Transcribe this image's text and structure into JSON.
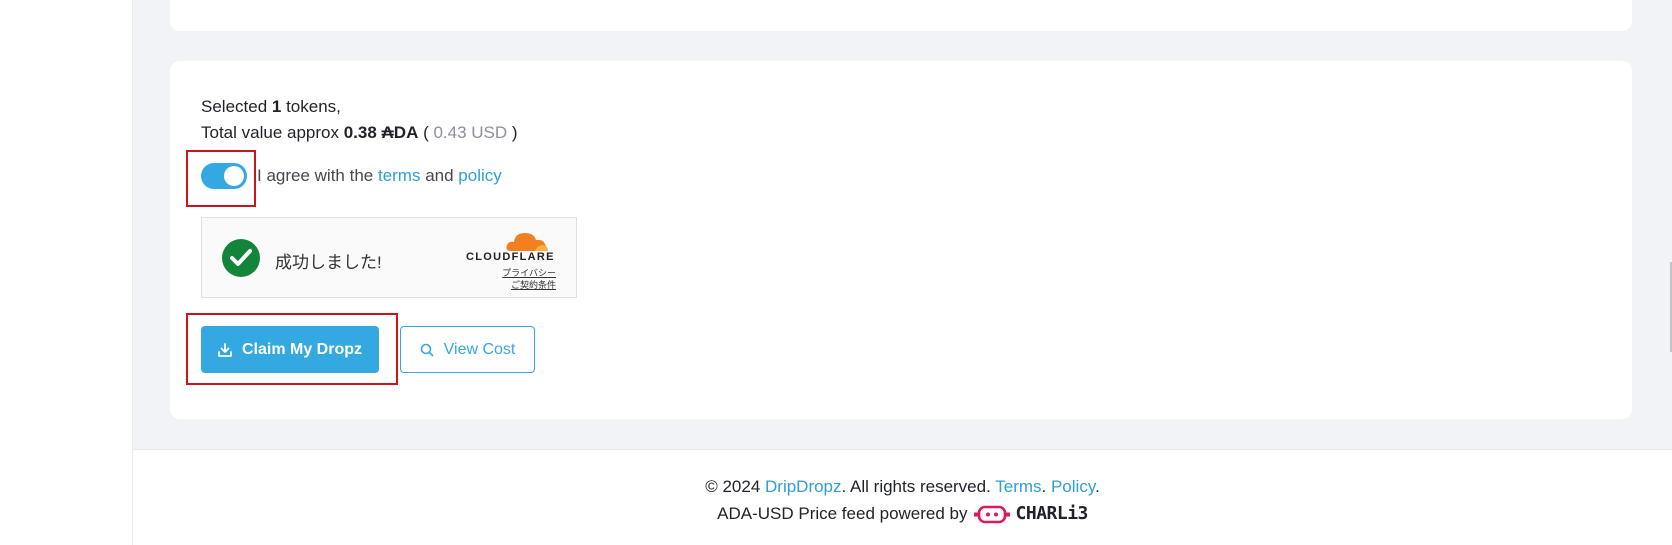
{
  "summary": {
    "line1_prefix": "Selected ",
    "token_count": "1",
    "line1_suffix": " tokens,",
    "line2_prefix": "Total value approx ",
    "ada_value": "0.38 ₳DA",
    "paren_open": " ( ",
    "usd_value": "0.43 USD",
    "paren_close": " )"
  },
  "agreement": {
    "toggle_on": true,
    "text_prefix": "I agree with the ",
    "terms_link": "terms",
    "text_mid": " and ",
    "policy_link": "policy"
  },
  "captcha": {
    "status_text": "成功しました!",
    "brand": "CLOUDFLARE",
    "privacy_link": "プライバシー",
    "terms_link": "ご契約条件"
  },
  "buttons": {
    "claim_label": "Claim My Dropz",
    "view_cost_label": "View Cost"
  },
  "footer": {
    "copyright_prefix": "© 2024 ",
    "brand_link": "DripDropz",
    "rights_text": ". All rights reserved. ",
    "terms_link": "Terms",
    "sep": ". ",
    "policy_link": "Policy",
    "end": ".",
    "price_feed_text": "ADA-USD Price feed powered by",
    "partner_name": "CHARLi3"
  },
  "colors": {
    "accent": "#34a8e1",
    "success": "#13853b",
    "highlight": "#c8171b",
    "cloudflare": "#f38020"
  },
  "icons": {
    "claim": "download-icon",
    "view_cost": "search-icon",
    "captcha_status": "check-circle-icon",
    "brand": "cloudflare-logo",
    "partner": "charli3-logo"
  }
}
